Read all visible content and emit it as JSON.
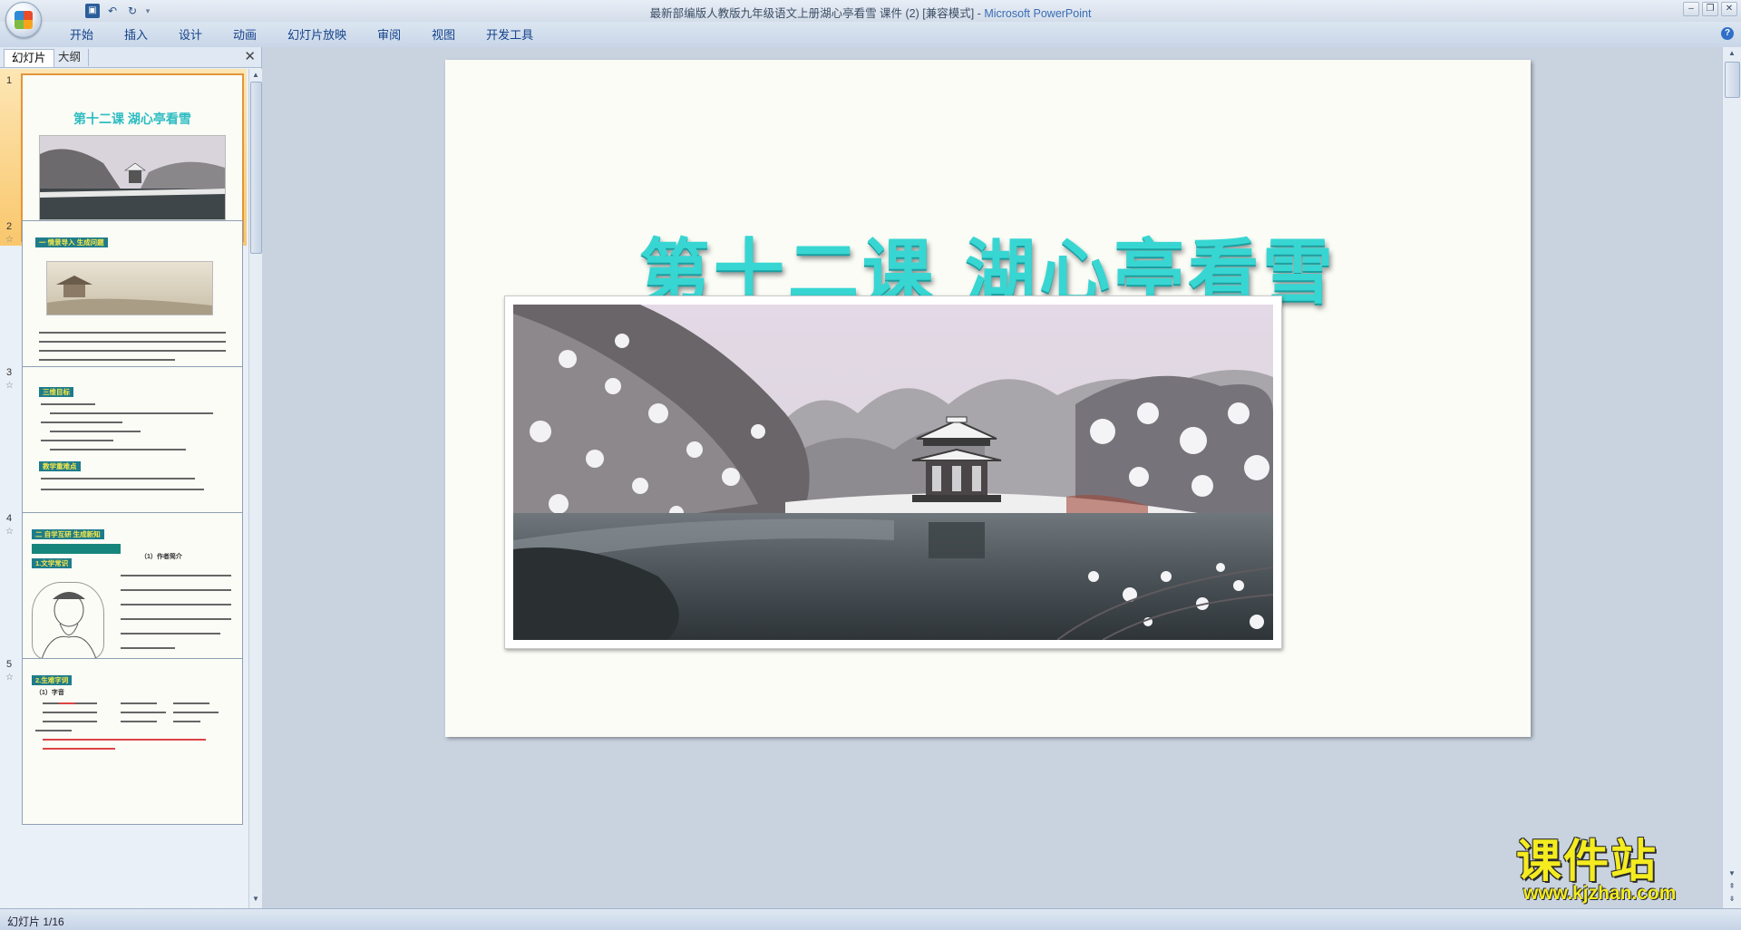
{
  "window": {
    "title": "最新部编版人教版九年级语文上册湖心亭看雪 课件 (2) [兼容模式] - ",
    "app_name": "Microsoft PowerPoint",
    "controls": [
      "–",
      "❐",
      "✕"
    ]
  },
  "quick_access": {
    "save_icon": "save-icon",
    "undo_icon": "undo-icon",
    "redo_icon": "redo-icon"
  },
  "ribbon": {
    "tabs": [
      "开始",
      "插入",
      "设计",
      "动画",
      "幻灯片放映",
      "审阅",
      "视图",
      "开发工具"
    ],
    "help": "?"
  },
  "left_pane": {
    "tabs": [
      "幻灯片",
      "大纲"
    ],
    "close": "✕",
    "slides": [
      {
        "number": "1",
        "title": "第十二课  湖心亭看雪"
      },
      {
        "number": "2",
        "tag": "一   情景导入   生成问题"
      },
      {
        "number": "3",
        "tag": "三维目标",
        "tag2": "教学重难点"
      },
      {
        "number": "4",
        "tag": "二   自学互研   生成新知",
        "tag2": "1.文学常识",
        "author_line": "（1）作者简介"
      },
      {
        "number": "5",
        "tag": "2.生难字词",
        "sub": "（1）字音"
      }
    ]
  },
  "slide": {
    "title": "第十二课  湖心亭看雪"
  },
  "status": {
    "slide_counter": "幻灯片 1/16"
  },
  "watermark": {
    "text": "课件站",
    "url": "www.kjzhan.com"
  },
  "colors": {
    "title_cyan": "#38d6d2",
    "selection_orange": "#f9c76c",
    "watermark_yellow": "#f4ec1f"
  }
}
